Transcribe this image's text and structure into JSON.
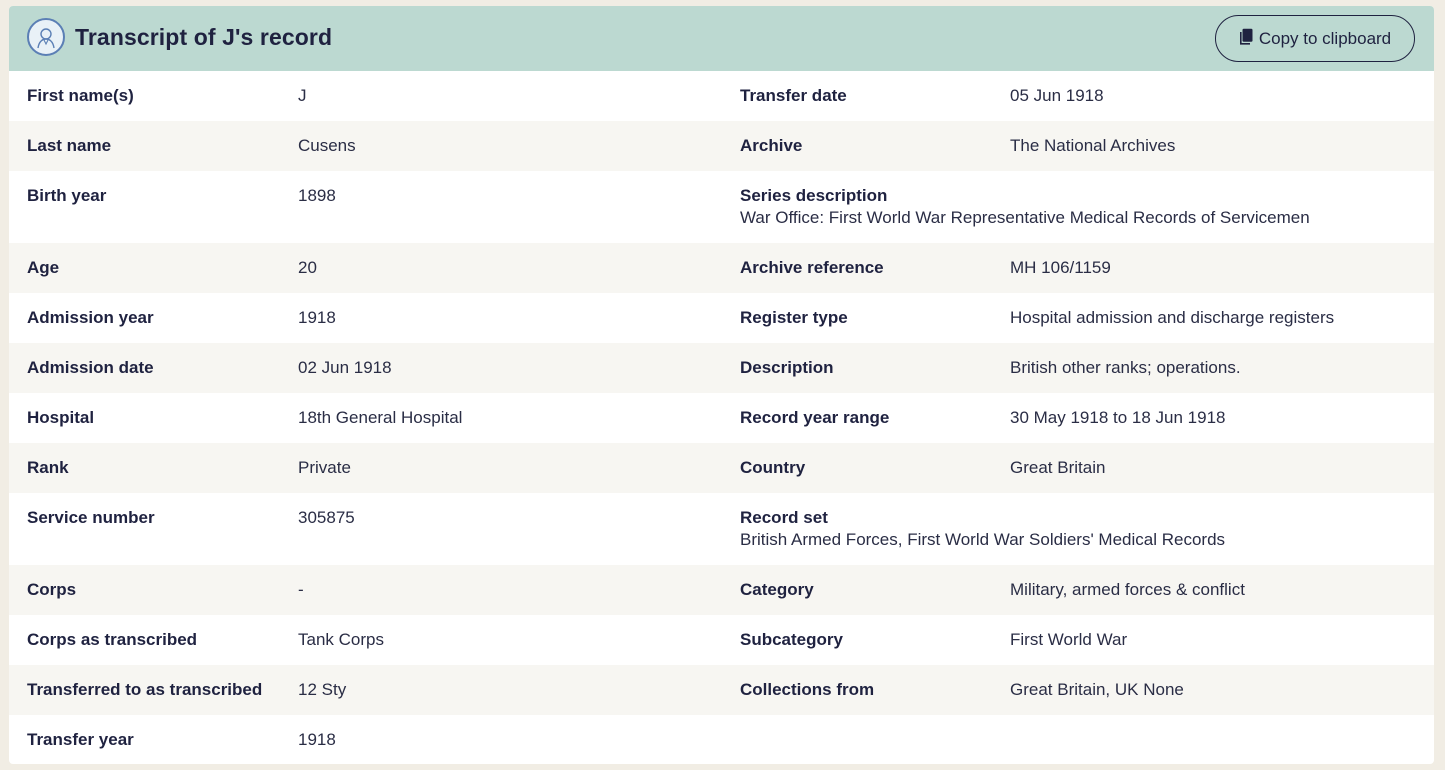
{
  "header": {
    "title": "Transcript of J's record",
    "copy_label": "Copy to clipboard"
  },
  "left": [
    {
      "label": "First name(s)",
      "value": "J"
    },
    {
      "label": "Last name",
      "value": "Cusens"
    },
    {
      "label": "Birth year",
      "value": "1898"
    },
    {
      "label": "Age",
      "value": "20"
    },
    {
      "label": "Admission year",
      "value": "1918"
    },
    {
      "label": "Admission date",
      "value": "02 Jun 1918"
    },
    {
      "label": "Hospital",
      "value": "18th General Hospital"
    },
    {
      "label": "Rank",
      "value": "Private"
    },
    {
      "label": "Service number",
      "value": "305875"
    },
    {
      "label": "Corps",
      "value": "-"
    },
    {
      "label": "Corps as transcribed",
      "value": "Tank Corps"
    },
    {
      "label": "Transferred to as transcribed",
      "value": "12 Sty"
    },
    {
      "label": "Transfer year",
      "value": "1918"
    }
  ],
  "right": [
    {
      "label": "Transfer date",
      "value": "05 Jun 1918"
    },
    {
      "label": "Archive",
      "value": "The National Archives"
    },
    {
      "label": "Series description",
      "value": "War Office: First World War Representative Medical Records of Servicemen"
    },
    {
      "label": "Archive reference",
      "value": "MH 106/1159"
    },
    {
      "label": "Register type",
      "value": "Hospital admission and discharge registers"
    },
    {
      "label": "Description",
      "value": "British other ranks; operations."
    },
    {
      "label": "Record year range",
      "value": "30 May 1918 to 18 Jun 1918"
    },
    {
      "label": "Country",
      "value": "Great Britain"
    },
    {
      "label": "Record set",
      "value": "British Armed Forces, First World War Soldiers' Medical Records"
    },
    {
      "label": "Category",
      "value": "Military, armed forces & conflict"
    },
    {
      "label": "Subcategory",
      "value": "First World War"
    },
    {
      "label": "Collections from",
      "value": "Great Britain, UK None"
    }
  ]
}
